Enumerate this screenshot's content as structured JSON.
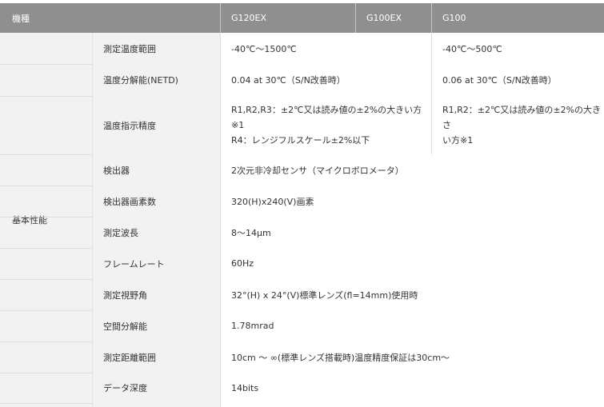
{
  "header": {
    "model_label": "機種",
    "models": [
      "G120EX",
      "G100EX",
      "G100"
    ]
  },
  "section": {
    "label": "基本性能"
  },
  "rows": [
    {
      "label": "測定温度範囲",
      "g120": "-40℃〜1500℃",
      "g100": "-40℃〜500℃"
    },
    {
      "label": "温度分解能(NETD)",
      "g120": "0.04 at 30℃（S/N改善時）",
      "g100": "0.06 at 30℃（S/N改善時）"
    },
    {
      "label": "温度指示精度",
      "g120_lines": [
        "R1,R2,R3：±2℃又は読み値の±2%の大きい方",
        "※1",
        "R4：レンジフルスケール±2%以下"
      ],
      "g100_lines": [
        "R1,R2：±2℃又は読み値の±2%の大きさ",
        "い方※1"
      ]
    },
    {
      "label": "検出器",
      "value": "2次元非冷却センサ（マイクロボロメータ）"
    },
    {
      "label": "検出器画素数",
      "value": "320(H)x240(V)画素"
    },
    {
      "label": "測定波長",
      "value": "8〜14μm"
    },
    {
      "label": "フレームレート",
      "value": "60Hz"
    },
    {
      "label": "測定視野角",
      "value": "32°(H) x 24°(V)標準レンズ(fl=14mm)使用時"
    },
    {
      "label": "空間分解能",
      "value": "1.78mrad"
    },
    {
      "label": "測定距離範囲",
      "value": "10cm 〜 ∞(標準レンズ搭載時)温度精度保証は30cm〜"
    },
    {
      "label": "データ深度",
      "value": "14bits"
    }
  ]
}
